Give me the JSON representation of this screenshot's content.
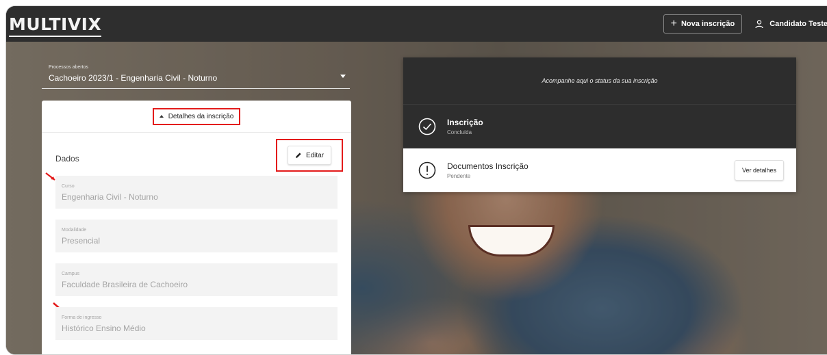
{
  "header": {
    "logo": "MULTIVIX",
    "new_button_label": "Nova inscrição",
    "user_label": "Candidato Teste"
  },
  "process_select": {
    "label": "Processos abertos",
    "value": "Cachoeiro 2023/1 - Engenharia Civil - Noturno"
  },
  "card": {
    "toggle_label": "Detalhes da inscrição",
    "section_title": "Dados",
    "edit_label": "Editar",
    "fields": [
      {
        "label": "Curso",
        "value": "Engenharia Civil - Noturno"
      },
      {
        "label": "Modalidade",
        "value": "Presencial"
      },
      {
        "label": "Campus",
        "value": "Faculdade Brasileira de Cachoeiro"
      },
      {
        "label": "Forma de ingresso",
        "value": "Histórico Ensino Médio"
      }
    ]
  },
  "status": {
    "heading": "Acompanhe aqui o status da sua inscrição",
    "items": [
      {
        "title": "Inscrição",
        "state": "Concluída",
        "icon": "check-circle-icon"
      },
      {
        "title": "Documentos Inscrição",
        "state": "Pendente",
        "icon": "exclamation-circle-icon",
        "action_label": "Ver detalhes"
      }
    ]
  },
  "colors": {
    "highlight": "#e31b1b",
    "dark_bar": "#2e2e2e"
  }
}
